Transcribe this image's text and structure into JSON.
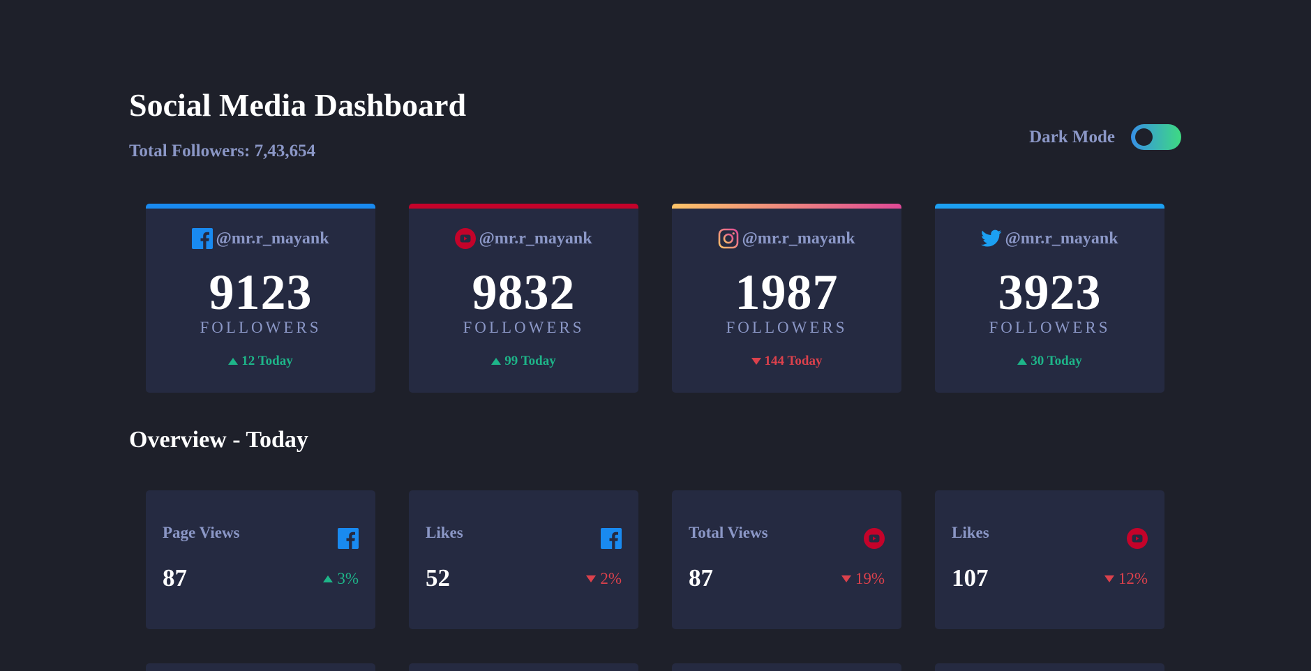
{
  "header": {
    "title": "Social Media Dashboard",
    "total_followers": "Total Followers: 7,43,654",
    "dark_mode_label": "Dark Mode"
  },
  "colors": {
    "background": "#1e202a",
    "card": "#252a41",
    "text_muted": "#8b97c6",
    "up": "#1eb589",
    "down": "#dc414c",
    "facebook": "#198af0",
    "youtube": "#c4032a",
    "twitter": "#1ca0f2",
    "instagram_gradient": [
      "#fdc468",
      "#df4996"
    ],
    "toggle_gradient": [
      "#378fe6",
      "#3eda82"
    ]
  },
  "follower_cards": [
    {
      "platform": "facebook-icon",
      "handle": "@mr.r_mayank",
      "count": "9123",
      "label": "FOLLOWERS",
      "today": "12 Today",
      "trend": "up"
    },
    {
      "platform": "youtube-icon",
      "handle": "@mr.r_mayank",
      "count": "9832",
      "label": "FOLLOWERS",
      "today": "99 Today",
      "trend": "up"
    },
    {
      "platform": "instagram-icon",
      "handle": "@mr.r_mayank",
      "count": "1987",
      "label": "FOLLOWERS",
      "today": "144 Today",
      "trend": "down"
    },
    {
      "platform": "twitter-icon",
      "handle": "@mr.r_mayank",
      "count": "3923",
      "label": "FOLLOWERS",
      "today": "30 Today",
      "trend": "up"
    }
  ],
  "overview": {
    "title": "Overview - Today",
    "cards": [
      {
        "label": "Page Views",
        "platform": "facebook-icon",
        "value": "87",
        "change": "3%",
        "trend": "up"
      },
      {
        "label": "Likes",
        "platform": "facebook-icon",
        "value": "52",
        "change": "2%",
        "trend": "down"
      },
      {
        "label": "Total Views",
        "platform": "youtube-icon",
        "value": "87",
        "change": "19%",
        "trend": "down"
      },
      {
        "label": "Likes",
        "platform": "youtube-icon",
        "value": "107",
        "change": "12%",
        "trend": "down"
      }
    ]
  }
}
